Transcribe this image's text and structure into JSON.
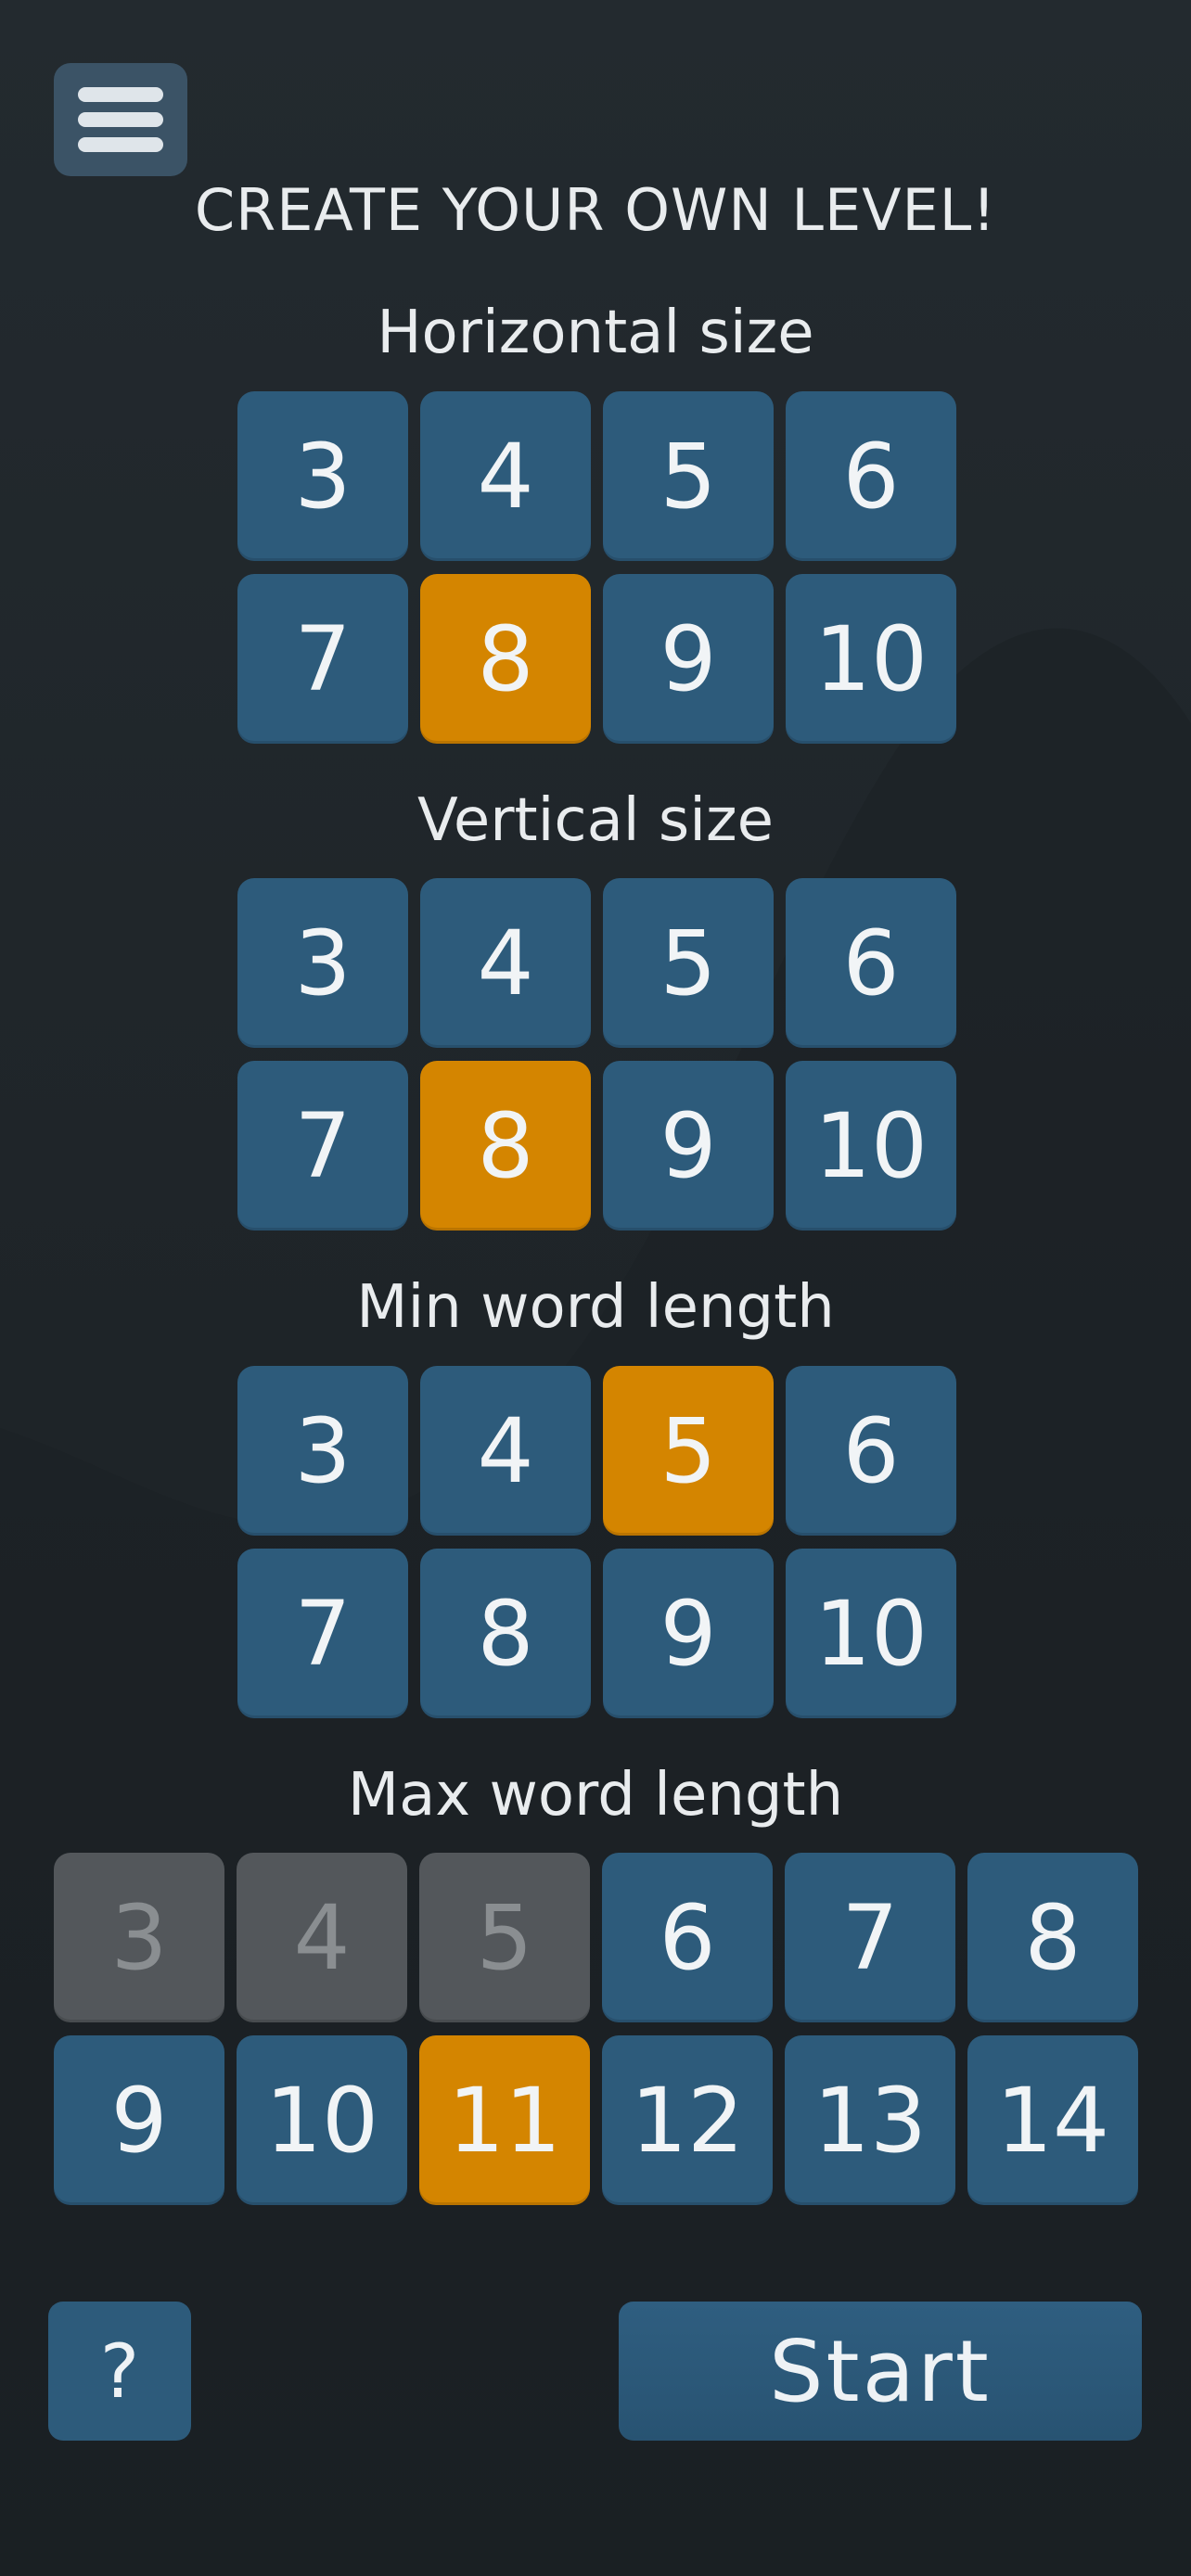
{
  "page": {
    "title": "CREATE YOUR OWN LEVEL!"
  },
  "menu": {
    "icon": "hamburger-menu-icon"
  },
  "sections": [
    {
      "label": "Horizontal size",
      "options": [
        "3",
        "4",
        "5",
        "6",
        "7",
        "8",
        "9",
        "10"
      ],
      "disabled": [],
      "selected": "8"
    },
    {
      "label": "Vertical size",
      "options": [
        "3",
        "4",
        "5",
        "6",
        "7",
        "8",
        "9",
        "10"
      ],
      "disabled": [],
      "selected": "8"
    },
    {
      "label": "Min word length",
      "options": [
        "3",
        "4",
        "5",
        "6",
        "7",
        "8",
        "9",
        "10"
      ],
      "disabled": [],
      "selected": "5"
    },
    {
      "label": "Max word length",
      "options": [
        "3",
        "4",
        "5",
        "6",
        "7",
        "8",
        "9",
        "10",
        "11",
        "12",
        "13",
        "14"
      ],
      "disabled": [
        "3",
        "4",
        "5"
      ],
      "selected": "11"
    }
  ],
  "footer": {
    "help_label": "?",
    "start_label": "Start"
  },
  "colors": {
    "tile": "#2d5b7b",
    "selected": "#d48500",
    "disabled": "#53575b",
    "background": "#1f2529"
  }
}
